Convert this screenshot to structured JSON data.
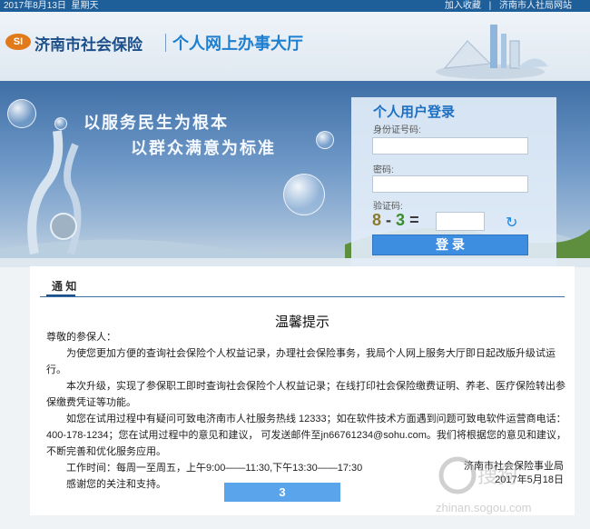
{
  "topbar": {
    "date": "2017年8月13日",
    "weekday": "星期天",
    "favorite": "加入收藏",
    "divider": "|",
    "site_link": "济南市人社局网站"
  },
  "header": {
    "logo": "SI",
    "org_name": "济南市社会保险",
    "system_name": "个人网上办事大厅"
  },
  "banner": {
    "slogan_line1": "以服务民生为根本",
    "slogan_line2": "以群众满意为标准"
  },
  "login": {
    "title": "个人用户登录",
    "id_label": "身份证号码:",
    "password_label": "密码:",
    "captcha_label": "验证码:",
    "captcha_a": "8",
    "captcha_op": "-",
    "captcha_b": "3",
    "captcha_eq": "=",
    "refresh_icon": "refresh-icon",
    "submit": "登 录"
  },
  "notice": {
    "tab_label": "通 知",
    "title": "温馨提示",
    "greeting": "尊敬的参保人：",
    "para1": "为使您更加方便的查询社会保险个人权益记录，办理社会保险事务，我局个人网上服务大厅即日起改版升级试运行。",
    "para2": "本次升级，实现了参保职工即时查询社会保险个人权益记录；在线打印社会保险缴费证明、养老、医疗保险转出参保缴费凭证等功能。",
    "para3": "如您在试用过程中有疑问可致电济南市人社服务热线 12333；如在软件技术方面遇到问题可致电软件运营商电话：400-178-1234；您在试用过程中的意见和建议， 可发送邮件至jn66761234@sohu.com。我们将根据您的意见和建议，不断完善和优化服务应用。",
    "hours": "工作时间：每周一至周五，上午9:00——11:30,下午13:30——17:30",
    "thanks": "感谢您的关注和支持。",
    "signer": "济南市社会保险事业局",
    "sign_date": "2017年5月18日"
  },
  "countdown": "3",
  "watermark": "zhinan.sogou.com",
  "colors": {
    "topbar": "#1f5f99",
    "brand_blue": "#1d7fd0",
    "login_button": "#3d8de0",
    "countdown_button": "#5aa4ec"
  }
}
